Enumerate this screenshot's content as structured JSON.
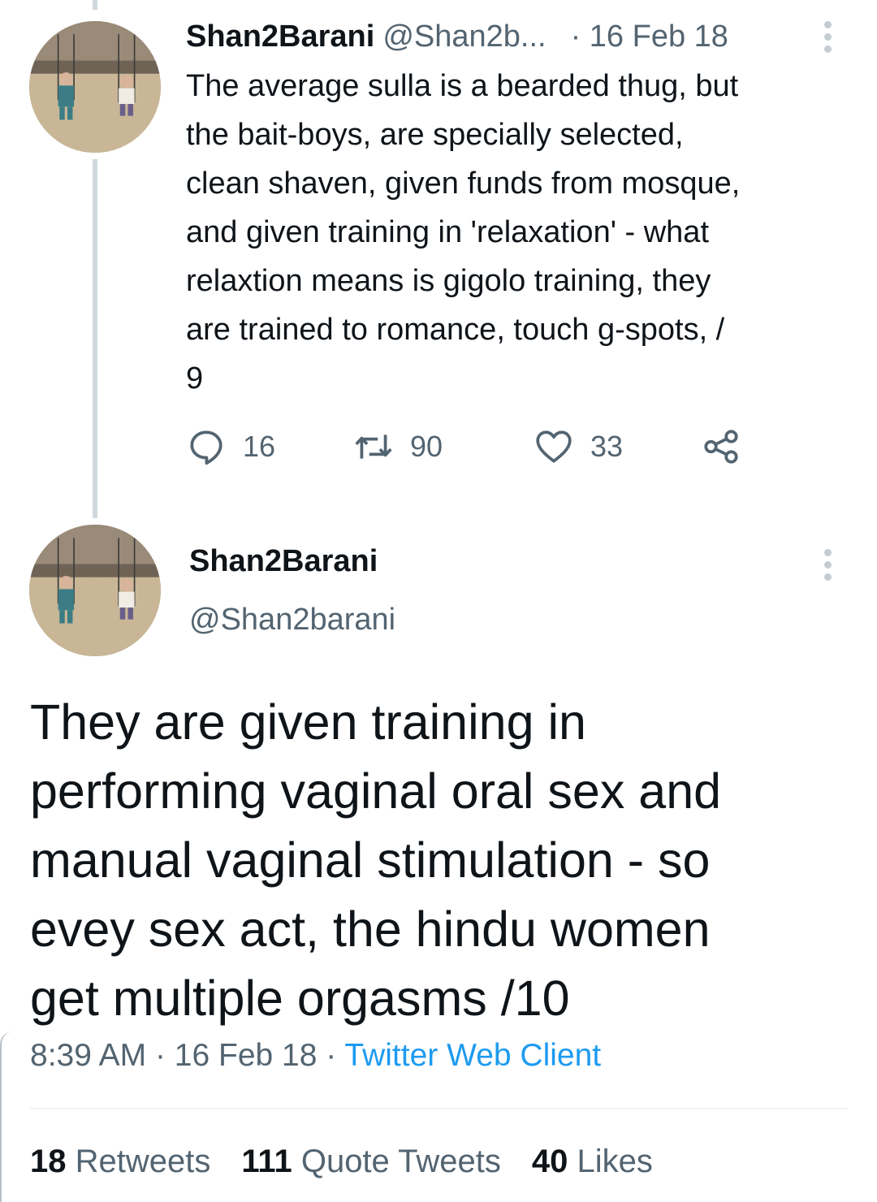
{
  "tweet1": {
    "name": "Shan2Barani",
    "handle": "@Shan2b...",
    "date": "· 16 Feb 18",
    "text": "The average sulla is a bearded thug, but\nthe bait-boys, are specially selected,\nclean shaven, given funds from mosque,\nand given training in 'relaxation' - what\nrelaxtion means is gigolo training, they\nare trained to romance, touch g-spots, /\n9",
    "actions": {
      "replies": "16",
      "retweets": "90",
      "likes": "33"
    }
  },
  "tweet2": {
    "name": "Shan2Barani",
    "handle": "@Shan2barani",
    "text": "They are given training in\nperforming  vaginal oral sex and\nmanual vaginal stimulation - so\nevey sex act, the hindu women\nget multiple orgasms /10",
    "time": "8:39 AM",
    "date": "16 Feb 18",
    "separator": "·",
    "source": "Twitter Web Client",
    "stats": {
      "retweets_count": "18",
      "retweets_label": "Retweets",
      "quotes_count": "111",
      "quotes_label": "Quote Tweets",
      "likes_count": "40",
      "likes_label": "Likes"
    }
  },
  "colors": {
    "text": "#0f1419",
    "secondary": "#536471",
    "accent": "#1d9bf0",
    "thread_line": "#cfd9de"
  },
  "icons": [
    "reply-icon",
    "retweet-icon",
    "like-icon",
    "share-icon",
    "more-icon"
  ]
}
